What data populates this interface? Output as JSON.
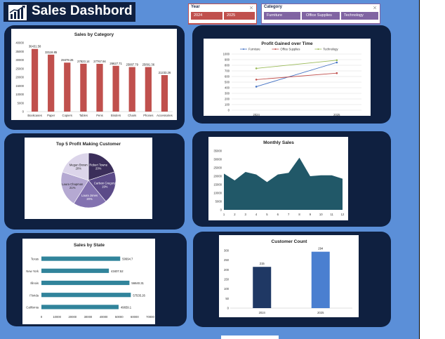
{
  "header": {
    "title": "Sales Dashbord",
    "logo_icon": "bar-chart-trend-icon"
  },
  "slicers": {
    "year": {
      "title": "Year",
      "options": [
        "2024",
        "2025"
      ],
      "color": "#c0504d"
    },
    "category": {
      "title": "Category",
      "options": [
        "Furniture",
        "Office Supplies",
        "Technology"
      ],
      "color": "#8064a2"
    }
  },
  "colors": {
    "background": "#5b8fd8",
    "panel": "#0f2040",
    "bar_red": "#c0504d",
    "teal": "#31849b",
    "area": "#215868",
    "navy": "#1f3864",
    "blue": "#4a7fd0"
  },
  "charts": {
    "sales_by_category": {
      "type": "bar",
      "title": "Sales by Category",
      "categories": [
        "Bookcases",
        "Paper",
        "Copiers",
        "Tables",
        "Pens",
        "Binders",
        "Chairs",
        "Phones",
        "Accessories"
      ],
      "values": [
        36431.58,
        33118.85,
        28478.26,
        27823.14,
        27767.94,
        26627.71,
        25887.79,
        25891.36,
        21233.26
      ],
      "labels": [
        "36431.58",
        "33118.85",
        "28478.26",
        "27823.14",
        "27767.94",
        "26627.71",
        "25887.79",
        "25891.36",
        "21233.26"
      ],
      "ylim": [
        0,
        40000
      ],
      "yticks": [
        "0",
        "5000",
        "10000",
        "15000",
        "20000",
        "25000",
        "30000",
        "35000",
        "40000"
      ]
    },
    "profit_over_time": {
      "type": "line",
      "title": "Profit Gained over Time",
      "categories": [
        "2024",
        "2025"
      ],
      "series": [
        {
          "name": "Furniture",
          "values": [
            420,
            850
          ],
          "color": "#4472c4"
        },
        {
          "name": "Office Supplies",
          "values": [
            545,
            660
          ],
          "color": "#c0504d"
        },
        {
          "name": "Technology",
          "values": [
            745,
            890
          ],
          "color": "#9bbb59"
        }
      ],
      "ylim": [
        0,
        1000
      ],
      "yticks": [
        "0",
        "100",
        "200",
        "300",
        "400",
        "500",
        "600",
        "700",
        "800",
        "900",
        "1000"
      ]
    },
    "top_customers": {
      "type": "pie",
      "title": "Top 5 Profit Making Customer",
      "slices": [
        {
          "name": "Robert Towne",
          "pct": 20,
          "label": "Robert Towne\n20%",
          "color": "#3b2e5a"
        },
        {
          "name": "Carlson Gregory",
          "pct": 19,
          "label": "Carlson Gregory\n19%",
          "color": "#5b4a88"
        },
        {
          "name": "Laura Jones",
          "pct": 20,
          "label": "Laura Jones\n20%",
          "color": "#8372b0"
        },
        {
          "name": "Laura Chapman",
          "pct": 21,
          "label": "Laura Chapman\n21%",
          "color": "#b5a9d2"
        },
        {
          "name": "Megan Brown",
          "pct": 20,
          "label": "Megan Brown\n20%",
          "color": "#dcd5ea"
        }
      ]
    },
    "monthly_sales": {
      "type": "area",
      "title": "Monthly Sales",
      "x": [
        "1",
        "2",
        "3",
        "4",
        "5",
        "6",
        "7",
        "8",
        "9",
        "10",
        "11",
        "12"
      ],
      "values": [
        21500,
        17500,
        22500,
        21000,
        16500,
        21000,
        22000,
        31000,
        20000,
        20500,
        20500,
        18500
      ],
      "ylim": [
        0,
        35000
      ],
      "yticks": [
        "0",
        "5000",
        "10000",
        "15000",
        "20000",
        "25000",
        "30000",
        "35000"
      ]
    },
    "sales_by_state": {
      "type": "bar",
      "orientation": "horizontal",
      "title": "Sales by State",
      "categories": [
        "Texas",
        "New York",
        "Illinois",
        "Florida",
        "California"
      ],
      "values": [
        50694.7,
        43407.52,
        56640.31,
        57535.26,
        49659.1
      ],
      "labels": [
        "50694.7",
        "43407.52",
        "56640.31",
        "57535.26",
        "49659.1"
      ],
      "xlim": [
        0,
        70000
      ],
      "xticks": [
        "0",
        "10000",
        "20000",
        "30000",
        "40000",
        "50000",
        "60000",
        "70000"
      ]
    },
    "customer_count": {
      "type": "bar",
      "title": "Customer Count",
      "categories": [
        "2024",
        "2025"
      ],
      "values": [
        215,
        294
      ],
      "labels": [
        "215",
        "294"
      ],
      "ylim": [
        0,
        300
      ],
      "yticks": [
        "0",
        "50",
        "100",
        "150",
        "200",
        "250",
        "300"
      ],
      "colors": [
        "#1f3864",
        "#4a7fd0"
      ]
    }
  },
  "chart_data": [
    {
      "type": "bar",
      "title": "Sales by Category",
      "categories": [
        "Bookcases",
        "Paper",
        "Copiers",
        "Tables",
        "Pens",
        "Binders",
        "Chairs",
        "Phones",
        "Accessories"
      ],
      "values": [
        36431.58,
        33118.85,
        28478.26,
        27823.14,
        27767.94,
        26627.71,
        25887.79,
        25891.36,
        21233.26
      ],
      "ylim": [
        0,
        40000
      ]
    },
    {
      "type": "line",
      "title": "Profit Gained over Time",
      "categories": [
        "2024",
        "2025"
      ],
      "series": [
        {
          "name": "Furniture",
          "values": [
            420,
            850
          ]
        },
        {
          "name": "Office Supplies",
          "values": [
            545,
            660
          ]
        },
        {
          "name": "Technology",
          "values": [
            745,
            890
          ]
        }
      ],
      "ylim": [
        0,
        1000
      ],
      "legend": "top"
    },
    {
      "type": "pie",
      "title": "Top 5 Profit Making Customer",
      "categories": [
        "Robert Towne",
        "Carlson Gregory",
        "Laura Jones",
        "Laura Chapman",
        "Megan Brown"
      ],
      "values": [
        20,
        19,
        20,
        21,
        20
      ]
    },
    {
      "type": "area",
      "title": "Monthly Sales",
      "x": [
        1,
        2,
        3,
        4,
        5,
        6,
        7,
        8,
        9,
        10,
        11,
        12
      ],
      "values": [
        21500,
        17500,
        22500,
        21000,
        16500,
        21000,
        22000,
        31000,
        20000,
        20500,
        20500,
        18500
      ],
      "ylim": [
        0,
        35000
      ]
    },
    {
      "type": "bar",
      "title": "Sales by State",
      "categories": [
        "Texas",
        "New York",
        "Illinois",
        "Florida",
        "California"
      ],
      "values": [
        50694.7,
        43407.52,
        56640.31,
        57535.26,
        49659.1
      ],
      "xlim": [
        0,
        70000
      ]
    },
    {
      "type": "bar",
      "title": "Customer Count",
      "categories": [
        "2024",
        "2025"
      ],
      "values": [
        215,
        294
      ],
      "ylim": [
        0,
        300
      ]
    }
  ]
}
